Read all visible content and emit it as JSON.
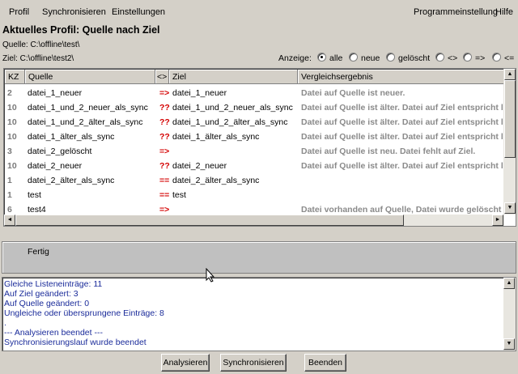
{
  "menu": {
    "left": [
      "Profil",
      "Synchronisieren",
      "Einstellungen"
    ],
    "right": [
      "Programmeinstellung",
      "Hilfe"
    ]
  },
  "profile": {
    "title": "Aktuelles Profil: Quelle nach Ziel",
    "quelle": "Quelle: C:\\offline\\test\\",
    "ziel": "Ziel: C:\\offline\\test2\\"
  },
  "filter": {
    "label": "Anzeige:",
    "options": [
      "alle",
      "neue",
      "gelöscht",
      "<>",
      "=>",
      "<="
    ],
    "selected": "alle"
  },
  "grid": {
    "columns": [
      "KZ",
      "Quelle",
      "<>",
      "Ziel",
      "Vergleichsergebnis"
    ],
    "rows": [
      {
        "kz": "2",
        "quelle": "datei_1_neuer",
        "op": "=>",
        "ziel": "datei_1_neuer",
        "erg": "Datei auf Quelle ist neuer."
      },
      {
        "kz": "10",
        "quelle": "datei_1_und_2_neuer_als_sync",
        "op": "??",
        "ziel": "datei_1_und_2_neuer_als_sync",
        "erg": "Datei auf Quelle ist älter. Datei auf Ziel entspricht l"
      },
      {
        "kz": "10",
        "quelle": "datei_1_und_2_älter_als_sync",
        "op": "??",
        "ziel": "datei_1_und_2_älter_als_sync",
        "erg": "Datei auf Quelle ist älter. Datei auf Ziel entspricht l"
      },
      {
        "kz": "10",
        "quelle": "datei_1_älter_als_sync",
        "op": "??",
        "ziel": "datei_1_älter_als_sync",
        "erg": "Datei auf Quelle ist älter. Datei auf Ziel entspricht l"
      },
      {
        "kz": "3",
        "quelle": "datei_2_gelöscht",
        "op": "=>",
        "ziel": "",
        "erg": "Datei auf Quelle ist neu. Datei fehlt auf Ziel."
      },
      {
        "kz": "10",
        "quelle": "datei_2_neuer",
        "op": "??",
        "ziel": "datei_2_neuer",
        "erg": "Datei auf Quelle ist älter. Datei auf Ziel entspricht l"
      },
      {
        "kz": "1",
        "quelle": "datei_2_älter_als_sync",
        "op": "==",
        "ziel": "datei_2_älter_als_sync",
        "erg": ""
      },
      {
        "kz": "1",
        "quelle": "test",
        "op": "==",
        "ziel": "test",
        "erg": ""
      },
      {
        "kz": "6",
        "quelle": "test4",
        "op": "=>",
        "ziel": "",
        "erg": "Datei vorhanden auf Quelle, Datei wurde gelöscht"
      }
    ]
  },
  "status": {
    "text": "Fertig"
  },
  "log": {
    "lines": [
      "Gleiche Listeneinträge: 11",
      "Auf Ziel geändert: 3",
      "Auf Quelle geändert: 0",
      "Ungleiche oder übersprungene Einträge: 8",
      ".",
      "--- Analysieren beendet ---",
      " Synchronisierungslauf wurde beendet"
    ]
  },
  "buttons": {
    "analyze": "Analysieren",
    "sync": "Synchronisieren",
    "quit": "Beenden"
  }
}
